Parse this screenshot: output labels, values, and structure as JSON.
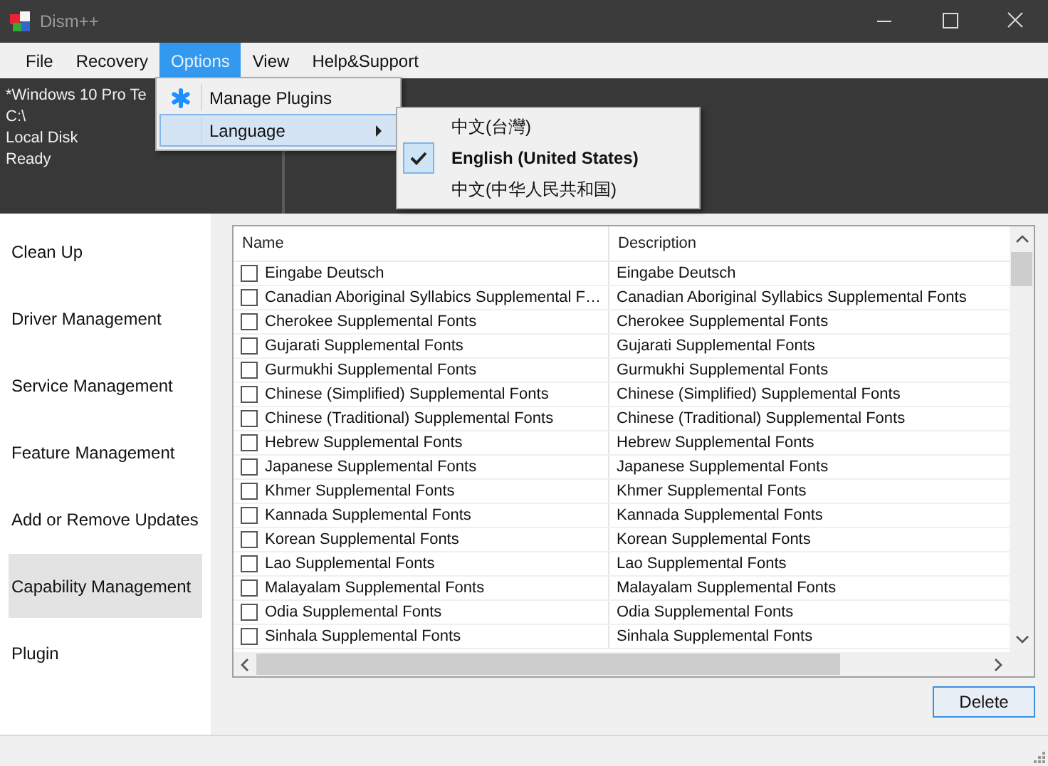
{
  "window": {
    "title": "Dism++"
  },
  "menu_bar": [
    {
      "label": "File",
      "selected": false
    },
    {
      "label": "Recovery",
      "selected": false
    },
    {
      "label": "Options",
      "selected": true
    },
    {
      "label": "View",
      "selected": false
    },
    {
      "label": "Help&Support",
      "selected": false
    }
  ],
  "options_menu": [
    {
      "label": "Manage Plugins",
      "kind": "plugin",
      "selected": false
    },
    {
      "label": "Language",
      "kind": "submenu",
      "selected": true
    }
  ],
  "language_menu": [
    {
      "label": "中文(台灣)",
      "checked": false
    },
    {
      "label": "English (United States)",
      "checked": true
    },
    {
      "label": "中文(中华人民共和国)",
      "checked": false
    }
  ],
  "info_panel": [
    "*Windows 10 Pro Te",
    "C:\\",
    "Local Disk",
    "Ready"
  ],
  "sidebar": [
    {
      "label": "Clean Up",
      "selected": false
    },
    {
      "label": "Driver Management",
      "selected": false
    },
    {
      "label": "Service Management",
      "selected": false
    },
    {
      "label": "Feature Management",
      "selected": false
    },
    {
      "label": "Add or Remove Updates",
      "selected": false
    },
    {
      "label": "Capability Management",
      "selected": true
    },
    {
      "label": "Plugin",
      "selected": false
    }
  ],
  "table": {
    "columns": [
      "Name",
      "Description"
    ],
    "rows": [
      {
        "name": "Eingabe Deutsch",
        "description": "Eingabe Deutsch",
        "checked": false
      },
      {
        "name": "Canadian Aboriginal Syllabics Supplemental F…",
        "description": "Canadian Aboriginal Syllabics Supplemental Fonts",
        "checked": false
      },
      {
        "name": "Cherokee Supplemental Fonts",
        "description": "Cherokee Supplemental Fonts",
        "checked": false
      },
      {
        "name": "Gujarati Supplemental Fonts",
        "description": "Gujarati Supplemental Fonts",
        "checked": false
      },
      {
        "name": "Gurmukhi Supplemental Fonts",
        "description": "Gurmukhi Supplemental Fonts",
        "checked": false
      },
      {
        "name": "Chinese (Simplified) Supplemental Fonts",
        "description": "Chinese (Simplified) Supplemental Fonts",
        "checked": false
      },
      {
        "name": "Chinese (Traditional) Supplemental Fonts",
        "description": "Chinese (Traditional) Supplemental Fonts",
        "checked": false
      },
      {
        "name": "Hebrew Supplemental Fonts",
        "description": "Hebrew Supplemental Fonts",
        "checked": false
      },
      {
        "name": "Japanese Supplemental Fonts",
        "description": "Japanese Supplemental Fonts",
        "checked": false
      },
      {
        "name": "Khmer Supplemental Fonts",
        "description": "Khmer Supplemental Fonts",
        "checked": false
      },
      {
        "name": "Kannada Supplemental Fonts",
        "description": "Kannada Supplemental Fonts",
        "checked": false
      },
      {
        "name": "Korean Supplemental Fonts",
        "description": "Korean Supplemental Fonts",
        "checked": false
      },
      {
        "name": "Lao Supplemental Fonts",
        "description": "Lao Supplemental Fonts",
        "checked": false
      },
      {
        "name": "Malayalam Supplemental Fonts",
        "description": "Malayalam Supplemental Fonts",
        "checked": false
      },
      {
        "name": "Odia Supplemental Fonts",
        "description": "Odia Supplemental Fonts",
        "checked": false
      },
      {
        "name": "Sinhala Supplemental Fonts",
        "description": "Sinhala Supplemental Fonts",
        "checked": false
      }
    ]
  },
  "buttons": [
    {
      "label": "Delete"
    }
  ]
}
